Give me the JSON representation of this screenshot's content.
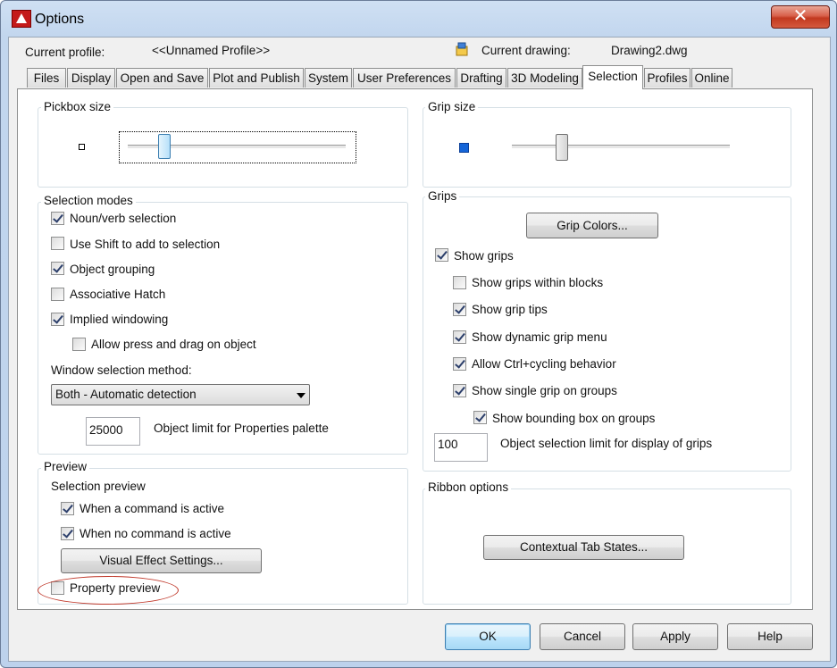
{
  "window": {
    "title": "Options"
  },
  "header": {
    "current_profile_label": "Current profile:",
    "current_profile_value": "<<Unnamed Profile>>",
    "current_drawing_label": "Current drawing:",
    "current_drawing_value": "Drawing2.dwg"
  },
  "tabs": [
    "Files",
    "Display",
    "Open and Save",
    "Plot and Publish",
    "System",
    "User Preferences",
    "Drafting",
    "3D Modeling",
    "Selection",
    "Profiles",
    "Online"
  ],
  "active_tab": "Selection",
  "pickbox": {
    "label": "Pickbox size",
    "level": 0.17
  },
  "grip_size": {
    "label": "Grip size",
    "level": 0.23
  },
  "selection_modes": {
    "label": "Selection modes",
    "noun_verb": {
      "label": "Noun/verb selection",
      "checked": true
    },
    "use_shift": {
      "label": "Use Shift to add to selection",
      "checked": false
    },
    "object_grouping": {
      "label": "Object grouping",
      "checked": true
    },
    "associative_hatch": {
      "label": "Associative Hatch",
      "checked": false
    },
    "implied_windowing": {
      "label": "Implied windowing",
      "checked": true
    },
    "allow_press_drag": {
      "label": "Allow press and drag on object",
      "checked": false
    },
    "window_method_label": "Window selection method:",
    "window_method_value": "Both - Automatic detection",
    "object_limit_value": "25000",
    "object_limit_label": "Object limit for Properties palette"
  },
  "preview": {
    "label": "Preview",
    "selection_preview_label": "Selection preview",
    "when_active": {
      "label": "When a command is active",
      "checked": true
    },
    "when_no_command": {
      "label": "When no command is active",
      "checked": true
    },
    "visual_effect_button": "Visual Effect Settings...",
    "property_preview": {
      "label": "Property preview",
      "checked": false
    }
  },
  "grips": {
    "label": "Grips",
    "grip_colors_button": "Grip Colors...",
    "show_grips": {
      "label": "Show grips",
      "checked": true
    },
    "within_blocks": {
      "label": "Show grips within blocks",
      "checked": false
    },
    "grip_tips": {
      "label": "Show grip tips",
      "checked": true
    },
    "dynamic_menu": {
      "label": "Show dynamic grip menu",
      "checked": true
    },
    "ctrl_cycling": {
      "label": "Allow Ctrl+cycling behavior",
      "checked": true
    },
    "single_grip": {
      "label": "Show single grip on groups",
      "checked": true
    },
    "bounding_box": {
      "label": "Show bounding box on groups",
      "checked": true
    },
    "limit_value": "100",
    "limit_label": "Object selection limit for display of grips"
  },
  "ribbon": {
    "label": "Ribbon options",
    "contextual_button": "Contextual Tab States..."
  },
  "footer": {
    "ok": "OK",
    "cancel": "Cancel",
    "apply": "Apply",
    "help": "Help"
  },
  "colors": {
    "grip_square": "#1565d8",
    "highlight_ellipse": "#c0392b",
    "close_button": "#c9452b"
  },
  "icons": {
    "app": "autocad-icon",
    "drawing": "drawing-icon",
    "close": "close-icon"
  }
}
